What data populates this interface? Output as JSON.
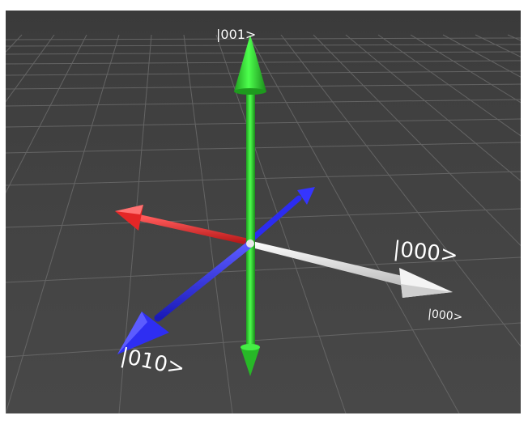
{
  "scene": {
    "colors": {
      "background": "#404040",
      "grid_line": "#6e6e6e",
      "axis_z": "#2bd42b",
      "axis_y": "#2c2cf0",
      "axis_x_pos": "#e82a2a",
      "axis_x_neg": "#f2f2f2",
      "label": "#ffffff"
    },
    "labels": {
      "ket_001": "|001>",
      "ket_000_large": "|000>",
      "ket_000_small": "|000>",
      "ket_010": "|010>"
    }
  }
}
